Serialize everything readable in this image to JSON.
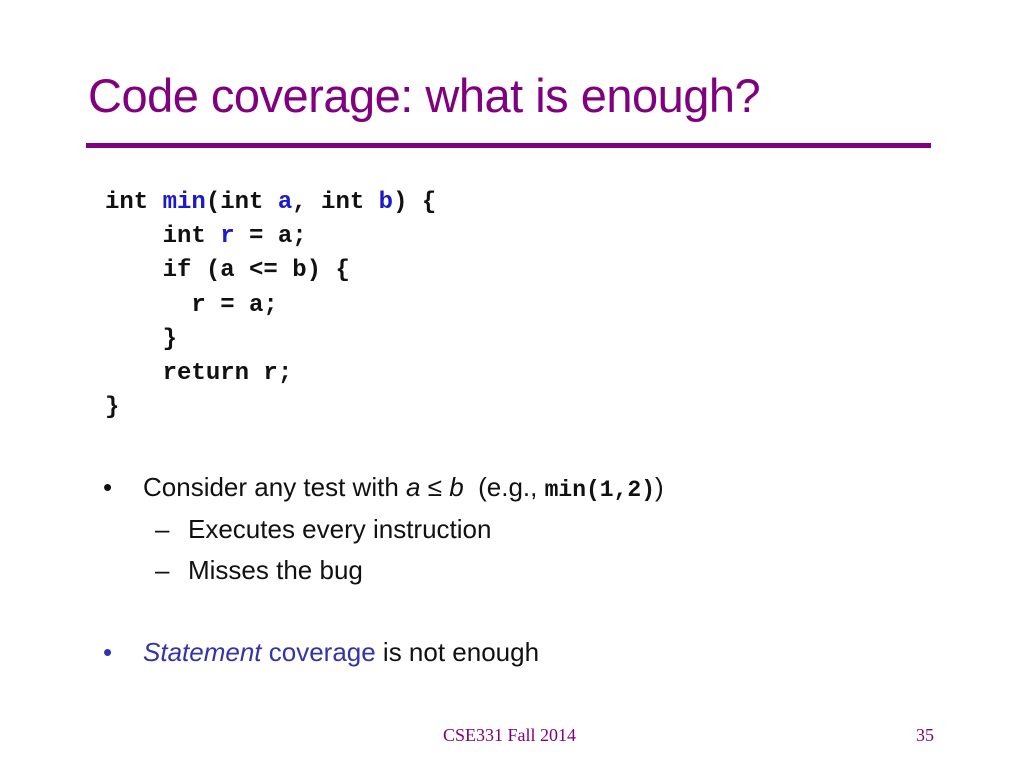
{
  "slide": {
    "title": "Code coverage: what is enough?",
    "code_lines": [
      {
        "parts": [
          {
            "t": "int ",
            "c": ""
          },
          {
            "t": "min",
            "c": "blue"
          },
          {
            "t": "(int ",
            "c": ""
          },
          {
            "t": "a",
            "c": "blue"
          },
          {
            "t": ", int ",
            "c": ""
          },
          {
            "t": "b",
            "c": "blue"
          },
          {
            "t": ") {",
            "c": ""
          }
        ]
      },
      {
        "parts": [
          {
            "t": "    int ",
            "c": ""
          },
          {
            "t": "r",
            "c": "blue"
          },
          {
            "t": " = a;",
            "c": ""
          }
        ]
      },
      {
        "parts": [
          {
            "t": "    if (a <= b) {",
            "c": ""
          }
        ]
      },
      {
        "parts": [
          {
            "t": "      r = a;",
            "c": ""
          }
        ]
      },
      {
        "parts": [
          {
            "t": "    }",
            "c": ""
          }
        ]
      },
      {
        "parts": [
          {
            "t": "    return r;",
            "c": ""
          }
        ]
      },
      {
        "parts": [
          {
            "t": "}",
            "c": ""
          }
        ]
      }
    ],
    "bullet1": {
      "marker": "•",
      "text_before": "Consider any test with ",
      "var_a": "a",
      "leq": " ≤ ",
      "var_b": "b",
      "paren_open": "  (e.g., ",
      "code": "min(1,2)",
      "paren_close": ")"
    },
    "sub_bullets": [
      {
        "marker": "–",
        "text": "Executes every instruction"
      },
      {
        "marker": "–",
        "text": "Misses the bug"
      }
    ],
    "bullet2": {
      "marker": "•",
      "italic": "Statement",
      "blue": " coverage",
      "rest": " is not enough"
    },
    "footer": {
      "course": "CSE331 Fall 2014",
      "page_number": "35"
    }
  },
  "colors": {
    "title": "#800080",
    "code_highlight": "#1a1acc",
    "emphasis": "#3333aa"
  }
}
